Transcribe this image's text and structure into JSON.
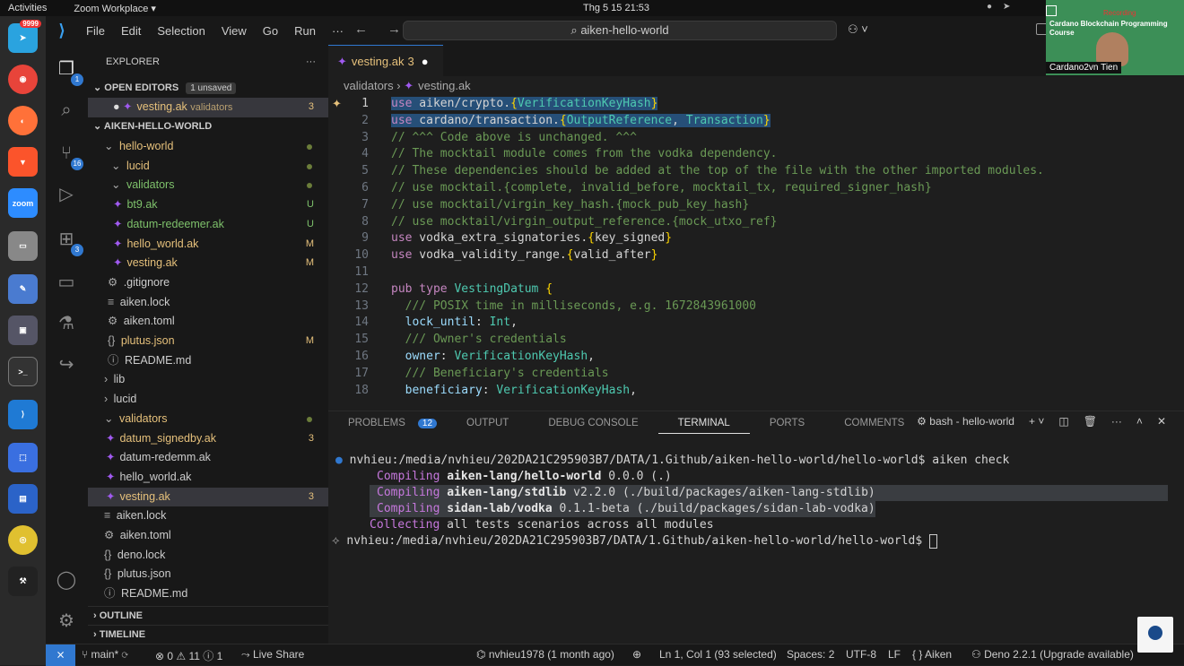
{
  "topbar": {
    "activities": "Activities",
    "zoom": "Zoom Workplace ▾",
    "clock": "Thg 5 15  21:53"
  },
  "dock": {
    "telegram_badge": "9999",
    "zoom_label": "zoom"
  },
  "vscode": {
    "menu": [
      "File",
      "Edit",
      "Selection",
      "View",
      "Go",
      "Run",
      "···"
    ],
    "search": "aiken-hello-world",
    "copilot": "⚇ ˅",
    "activity_badges": {
      "explorer": "1",
      "scm": "16",
      "extensions": "3"
    },
    "explorer": {
      "title": "EXPLORER",
      "more": "···",
      "open_editors": "OPEN EDITORS",
      "unsaved": "1 unsaved",
      "open_file": "vesting.ak",
      "open_file_path": "validators",
      "open_file_count": "3",
      "root": "AIKEN-HELLO-WORLD",
      "tree": [
        {
          "label": "hello-world",
          "icon": "⌄",
          "indent": 18,
          "color": "#e5c07b",
          "dot": true
        },
        {
          "label": "lucid",
          "icon": "⌄",
          "indent": 26,
          "color": "#e5c07b",
          "dot": true
        },
        {
          "label": "validators",
          "icon": "⌄",
          "indent": 26,
          "color": "#7ec16b",
          "dot": true
        },
        {
          "label": "bt9.ak",
          "icon": "aiken",
          "indent": 28,
          "color": "#7ec16b",
          "dec": "U",
          "decColor": "#7ec16b"
        },
        {
          "label": "datum-redeemer.ak",
          "icon": "aiken",
          "indent": 28,
          "color": "#7ec16b",
          "dec": "U",
          "decColor": "#7ec16b"
        },
        {
          "label": "hello_world.ak",
          "icon": "aiken",
          "indent": 28,
          "color": "#e5c07b",
          "dec": "M",
          "decColor": "#e5c07b"
        },
        {
          "label": "vesting.ak",
          "icon": "aiken",
          "indent": 28,
          "color": "#e5c07b",
          "dec": "M",
          "decColor": "#e5c07b"
        },
        {
          "label": ".gitignore",
          "icon": "⚙",
          "indent": 22,
          "color": "#ccc"
        },
        {
          "label": "aiken.lock",
          "icon": "≡",
          "indent": 22,
          "color": "#ccc"
        },
        {
          "label": "aiken.toml",
          "icon": "⚙",
          "indent": 22,
          "color": "#ccc"
        },
        {
          "label": "plutus.json",
          "icon": "{}",
          "indent": 22,
          "color": "#e5c07b",
          "dec": "M",
          "decColor": "#e5c07b"
        },
        {
          "label": "README.md",
          "icon": "ⓘ",
          "indent": 22,
          "color": "#ccc"
        },
        {
          "label": "lib",
          "icon": "›",
          "indent": 18,
          "color": "#ccc"
        },
        {
          "label": "lucid",
          "icon": "›",
          "indent": 18,
          "color": "#ccc"
        },
        {
          "label": "validators",
          "icon": "⌄",
          "indent": 18,
          "color": "#e5c07b",
          "dot": true
        },
        {
          "label": "datum_signedby.ak",
          "icon": "aiken",
          "indent": 20,
          "color": "#e5c07b",
          "dec": "3",
          "decColor": "#e5c07b"
        },
        {
          "label": "datum-redemm.ak",
          "icon": "aiken",
          "indent": 20,
          "color": "#ccc"
        },
        {
          "label": "hello_world.ak",
          "icon": "aiken",
          "indent": 20,
          "color": "#ccc"
        },
        {
          "label": "vesting.ak",
          "icon": "aiken",
          "indent": 20,
          "color": "#e5c07b",
          "dec": "3",
          "decColor": "#e5c07b",
          "selected": true
        },
        {
          "label": "aiken.lock",
          "icon": "≡",
          "indent": 18,
          "color": "#ccc"
        },
        {
          "label": "aiken.toml",
          "icon": "⚙",
          "indent": 18,
          "color": "#ccc"
        },
        {
          "label": "deno.lock",
          "icon": "{}",
          "indent": 18,
          "color": "#ccc"
        },
        {
          "label": "plutus.json",
          "icon": "{}",
          "indent": 18,
          "color": "#ccc"
        },
        {
          "label": "README.md",
          "icon": "ⓘ",
          "indent": 18,
          "color": "#ccc"
        }
      ],
      "outline": "OUTLINE",
      "timeline": "TIMELINE"
    },
    "tab": {
      "name": "vesting.ak",
      "count": "3",
      "dirty": "●"
    },
    "breadcrumb": {
      "folder": "validators",
      "sep": "›",
      "file": "vesting.ak"
    },
    "code": [
      {
        "n": "1",
        "html": "<span class='hl'><span class='kw'>use</span> aiken/crypto.<span class='br'>{</span><span class='ty'>VerificationKeyHash</span><span class='br'>}</span></span>"
      },
      {
        "n": "2",
        "html": "<span class='hl'><span class='kw'>use</span> cardano/transaction.<span class='br'>{</span><span class='ty'>OutputReference</span>, <span class='ty'>Transaction</span><span class='br'>}</span></span>"
      },
      {
        "n": "3",
        "html": "<span class='cm'>// ^^^ Code above is unchanged. ^^^</span>"
      },
      {
        "n": "4",
        "html": "<span class='cm'>// The mocktail module comes from the vodka dependency.</span>"
      },
      {
        "n": "5",
        "html": "<span class='cm'>// These dependencies should be added at the top of the file with the other imported modules.</span>"
      },
      {
        "n": "6",
        "html": "<span class='cm'>// use mocktail.{complete, invalid_before, mocktail_tx, required_signer_hash}</span>"
      },
      {
        "n": "7",
        "html": "<span class='cm'>// use mocktail/virgin_key_hash.{mock_pub_key_hash}</span>"
      },
      {
        "n": "8",
        "html": "<span class='cm'>// use mocktail/virgin_output_reference.{mock_utxo_ref}</span>"
      },
      {
        "n": "9",
        "html": "<span class='kw'>use</span> vodka_extra_signatories.<span class='br'>{</span>key_signed<span class='br'>}</span>"
      },
      {
        "n": "10",
        "html": "<span class='kw'>use</span> vodka_validity_range.<span class='br'>{</span>valid_after<span class='br'>}</span>"
      },
      {
        "n": "11",
        "html": ""
      },
      {
        "n": "12",
        "html": "<span class='kw'>pub type</span> <span class='ty'>VestingDatum</span> <span class='br'>{</span>"
      },
      {
        "n": "13",
        "html": "  <span class='cm'>/// POSIX time in milliseconds, e.g. 1672843961000</span>"
      },
      {
        "n": "14",
        "html": "  <span class='fn'>lock_until</span>: <span class='ty'>Int</span>,"
      },
      {
        "n": "15",
        "html": "  <span class='cm'>/// Owner's credentials</span>"
      },
      {
        "n": "16",
        "html": "  <span class='fn'>owner</span>: <span class='ty'>VerificationKeyHash</span>,"
      },
      {
        "n": "17",
        "html": "  <span class='cm'>/// Beneficiary's credentials</span>"
      },
      {
        "n": "18",
        "html": "  <span class='fn'>beneficiary</span>: <span class='ty'>VerificationKeyHash</span>,"
      }
    ],
    "panel": {
      "tabs": [
        "PROBLEMS",
        "OUTPUT",
        "DEBUG CONSOLE",
        "TERMINAL",
        "PORTS",
        "COMMENTS"
      ],
      "problems_count": "12",
      "active": "TERMINAL",
      "shell": "bash - hello-world"
    },
    "terminal": {
      "prompt1": "nvhieu:/media/nvhieu/202DA21C295903B7/DATA/1.Github/aiken-hello-world/hello-world$ aiken check",
      "c1_kw": "Compiling",
      "c1_pkg": "aiken-lang/hello-world",
      "c1_rest": " 0.0.0 (.)",
      "c2_kw": "Compiling",
      "c2_pkg": "aiken-lang/stdlib",
      "c2_rest": " v2.2.0 (./build/packages/aiken-lang-stdlib)",
      "c3_kw": "Compiling",
      "c3_pkg": "sidan-lab/vodka",
      "c3_rest": " 0.1.1-beta (./build/packages/sidan-lab-vodka)",
      "c4_kw": "Collecting",
      "c4_rest": " all tests scenarios across all modules",
      "prompt2": "nvhieu:/media/nvhieu/202DA21C295903B7/DATA/1.Github/aiken-hello-world/hello-world$ "
    },
    "status": {
      "branch": "main*",
      "sync": "⟳",
      "problems": "⊗ 0 ⚠ 11 ⓘ 1",
      "liveshare": "Live Share",
      "author": "nvhieu1978 (1 month ago)",
      "pos": "Ln 1, Col 1 (93 selected)",
      "spaces": "Spaces: 2",
      "enc": "UTF-8",
      "eol": "LF",
      "lang": "{ } Aiken",
      "deno": "Deno 2.2.1 (Upgrade available)"
    }
  },
  "video": {
    "title": "Cardano Blockchain Programming Course",
    "name": "Cardano2vn Tien",
    "rec": "Recording"
  }
}
